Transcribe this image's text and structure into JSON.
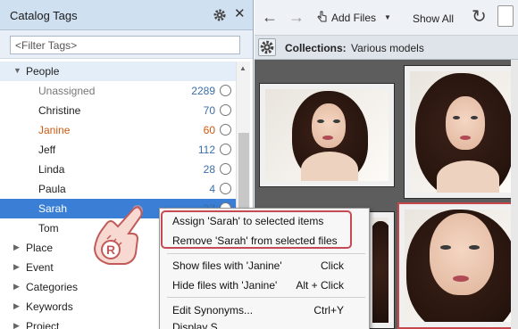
{
  "left_panel": {
    "title": "Catalog Tags",
    "filter_placeholder": "<Filter Tags>",
    "people_label": "People",
    "people": [
      {
        "name": "Unassigned",
        "count": "2289",
        "style": "gray"
      },
      {
        "name": "Christine",
        "count": "70",
        "style": ""
      },
      {
        "name": "Janine",
        "count": "60",
        "style": "orange"
      },
      {
        "name": "Jeff",
        "count": "112",
        "style": ""
      },
      {
        "name": "Linda",
        "count": "28",
        "style": ""
      },
      {
        "name": "Paula",
        "count": "4",
        "style": ""
      },
      {
        "name": "Sarah",
        "count": "37",
        "style": "selected"
      },
      {
        "name": "Tom",
        "count": "",
        "style": ""
      }
    ],
    "categories": [
      "Place",
      "Event",
      "Categories",
      "Keywords",
      "Project"
    ]
  },
  "toolbar": {
    "add_files": "Add Files",
    "show_all": "Show All"
  },
  "collections": {
    "label": "Collections:",
    "value": "Various models"
  },
  "context_menu": {
    "items": [
      {
        "label": "Assign  'Sarah'  to selected items",
        "shortcut": ""
      },
      {
        "label": "Remove  'Sarah'  from selected files",
        "shortcut": ""
      },
      {
        "label": "Show files with 'Janine'",
        "shortcut": "Click"
      },
      {
        "label": "Hide files with 'Janine'",
        "shortcut": "Alt + Click"
      },
      {
        "label": "Edit Synonyms...",
        "shortcut": "Ctrl+Y"
      },
      {
        "label": "Display S...",
        "shortcut": ""
      }
    ]
  },
  "pointer_badge": "R",
  "colors": {
    "accent": "#3a7fd5",
    "highlight_red": "#c64a54",
    "orange_text": "#cc5a12",
    "count_blue": "#3b6ea5"
  }
}
